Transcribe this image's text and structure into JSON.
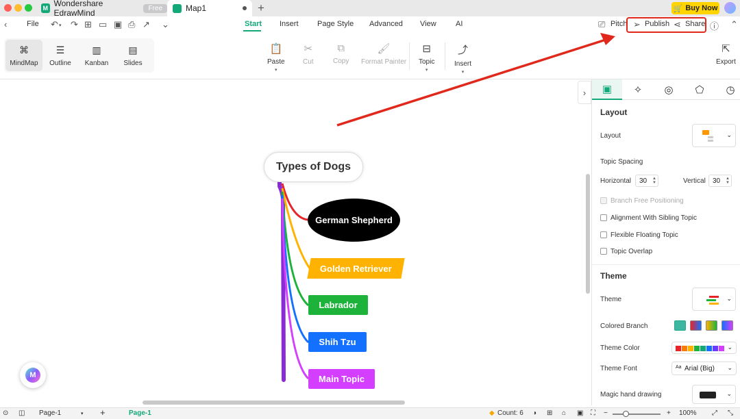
{
  "window": {
    "app_tab_title": "Wondershare EdrawMind",
    "free_badge": "Free",
    "doc_tab_title": "Map1",
    "new_tab_icon": "plus-icon",
    "buy_now_label": "Buy Now"
  },
  "menu": {
    "file_label": "File",
    "tabs": [
      "Start",
      "Insert",
      "Page Style",
      "Advanced",
      "View",
      "AI"
    ],
    "active_tab": "Start",
    "pitch_label": "Pitch",
    "publish_label": "Publish",
    "share_label": "Share"
  },
  "ribbon": {
    "views": [
      "MindMap",
      "Outline",
      "Kanban",
      "Slides"
    ],
    "selected_view": "MindMap",
    "tools": {
      "paste": "Paste",
      "cut": "Cut",
      "copy": "Copy",
      "format_painter": "Format Painter",
      "topic": "Topic",
      "insert": "Insert"
    },
    "export_label": "Export"
  },
  "mindmap": {
    "root": "Types of Dogs",
    "topics": [
      "German Shepherd",
      "Golden Retriever",
      "Labrador",
      "Shih Tzu",
      "Main Topic"
    ],
    "branch_colors": [
      "#e8242b",
      "#ffb300",
      "#1db33a",
      "#1471ff",
      "#d43fff"
    ],
    "root_branch_color": "#8b2bd6"
  },
  "panel": {
    "layout_heading": "Layout",
    "layout_label": "Layout",
    "topic_spacing_label": "Topic Spacing",
    "horizontal_label": "Horizontal",
    "horizontal_value": "30",
    "vertical_label": "Vertical",
    "vertical_value": "30",
    "checkboxes": [
      {
        "label": "Branch Free Positioning",
        "disabled": true
      },
      {
        "label": "Alignment With Sibling Topic",
        "disabled": false
      },
      {
        "label": "Flexible Floating Topic",
        "disabled": false
      },
      {
        "label": "Topic Overlap",
        "disabled": false
      }
    ],
    "theme_heading": "Theme",
    "theme_label": "Theme",
    "colored_branch_label": "Colored Branch",
    "theme_color_label": "Theme Color",
    "theme_font_label": "Theme Font",
    "theme_font_value": "Arial (Big)",
    "theme_font_prefix": "Aa",
    "magic_hand_label": "Magic hand drawing",
    "theme_colors": [
      "#e8242b",
      "#ff7a00",
      "#ffb300",
      "#1db33a",
      "#13a87a",
      "#1471ff",
      "#6a3cff",
      "#d43fff"
    ]
  },
  "status": {
    "page_tab": "Page-1",
    "active_page": "Page-1",
    "count_label": "Count: 6",
    "zoom": "100%"
  }
}
